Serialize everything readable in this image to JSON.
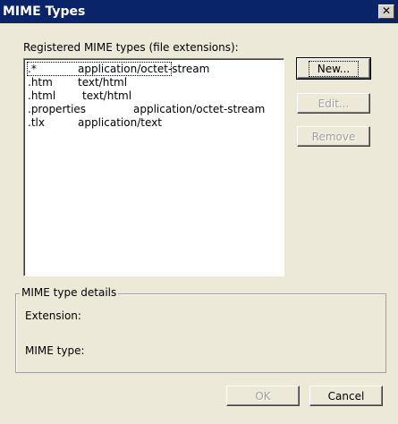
{
  "window": {
    "title": "MIME Types",
    "close_glyph": "✕"
  },
  "list": {
    "label": "Registered MIME types (file extensions):",
    "rows": [
      {
        "ext": ".*",
        "mime": "application/octet-stream"
      },
      {
        "ext": ".htm",
        "mime": "text/html"
      },
      {
        "ext": ".html",
        "mime": "text/html"
      },
      {
        "ext": ".properties",
        "mime": "application/octet-stream"
      },
      {
        "ext": ".tlx",
        "mime": "application/text"
      }
    ]
  },
  "buttons": {
    "new": "New...",
    "edit": "Edit...",
    "remove": "Remove",
    "ok": "OK",
    "cancel": "Cancel"
  },
  "details": {
    "title": "MIME type details",
    "extension_label": "Extension:",
    "mime_label": "MIME type:"
  }
}
